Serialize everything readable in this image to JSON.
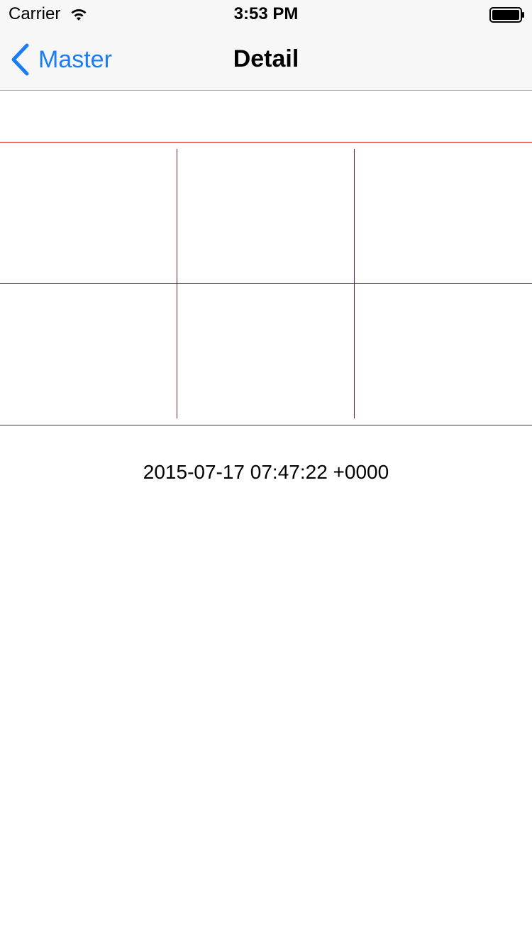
{
  "status_bar": {
    "carrier": "Carrier",
    "time": "3:53 PM",
    "wifi_icon": "wifi-icon",
    "battery_icon": "battery-icon"
  },
  "nav_bar": {
    "back_label": "Master",
    "back_icon": "chevron-left-icon",
    "title": "Detail"
  },
  "content": {
    "date_text": "2015-07-17 07:47:22 +0000"
  },
  "colors": {
    "accent": "#1a7cf7",
    "top_line": "#e0201c",
    "grid_line": "#5a1a8c"
  }
}
